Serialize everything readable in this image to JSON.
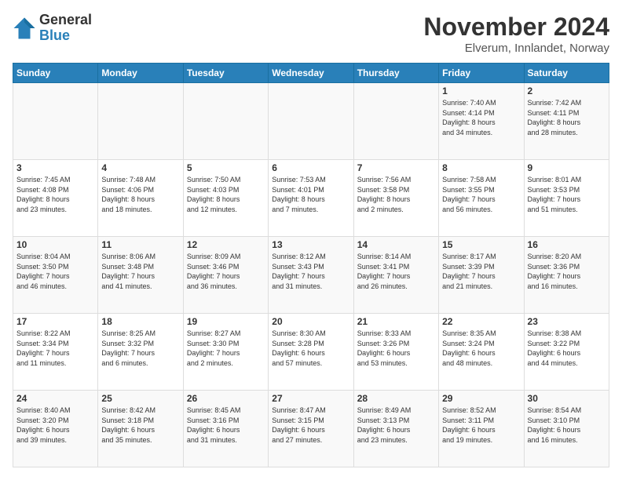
{
  "logo": {
    "general": "General",
    "blue": "Blue"
  },
  "title": "November 2024",
  "location": "Elverum, Innlandet, Norway",
  "days_of_week": [
    "Sunday",
    "Monday",
    "Tuesday",
    "Wednesday",
    "Thursday",
    "Friday",
    "Saturday"
  ],
  "weeks": [
    [
      {
        "day": "",
        "info": ""
      },
      {
        "day": "",
        "info": ""
      },
      {
        "day": "",
        "info": ""
      },
      {
        "day": "",
        "info": ""
      },
      {
        "day": "",
        "info": ""
      },
      {
        "day": "1",
        "info": "Sunrise: 7:40 AM\nSunset: 4:14 PM\nDaylight: 8 hours\nand 34 minutes."
      },
      {
        "day": "2",
        "info": "Sunrise: 7:42 AM\nSunset: 4:11 PM\nDaylight: 8 hours\nand 28 minutes."
      }
    ],
    [
      {
        "day": "3",
        "info": "Sunrise: 7:45 AM\nSunset: 4:08 PM\nDaylight: 8 hours\nand 23 minutes."
      },
      {
        "day": "4",
        "info": "Sunrise: 7:48 AM\nSunset: 4:06 PM\nDaylight: 8 hours\nand 18 minutes."
      },
      {
        "day": "5",
        "info": "Sunrise: 7:50 AM\nSunset: 4:03 PM\nDaylight: 8 hours\nand 12 minutes."
      },
      {
        "day": "6",
        "info": "Sunrise: 7:53 AM\nSunset: 4:01 PM\nDaylight: 8 hours\nand 7 minutes."
      },
      {
        "day": "7",
        "info": "Sunrise: 7:56 AM\nSunset: 3:58 PM\nDaylight: 8 hours\nand 2 minutes."
      },
      {
        "day": "8",
        "info": "Sunrise: 7:58 AM\nSunset: 3:55 PM\nDaylight: 7 hours\nand 56 minutes."
      },
      {
        "day": "9",
        "info": "Sunrise: 8:01 AM\nSunset: 3:53 PM\nDaylight: 7 hours\nand 51 minutes."
      }
    ],
    [
      {
        "day": "10",
        "info": "Sunrise: 8:04 AM\nSunset: 3:50 PM\nDaylight: 7 hours\nand 46 minutes."
      },
      {
        "day": "11",
        "info": "Sunrise: 8:06 AM\nSunset: 3:48 PM\nDaylight: 7 hours\nand 41 minutes."
      },
      {
        "day": "12",
        "info": "Sunrise: 8:09 AM\nSunset: 3:46 PM\nDaylight: 7 hours\nand 36 minutes."
      },
      {
        "day": "13",
        "info": "Sunrise: 8:12 AM\nSunset: 3:43 PM\nDaylight: 7 hours\nand 31 minutes."
      },
      {
        "day": "14",
        "info": "Sunrise: 8:14 AM\nSunset: 3:41 PM\nDaylight: 7 hours\nand 26 minutes."
      },
      {
        "day": "15",
        "info": "Sunrise: 8:17 AM\nSunset: 3:39 PM\nDaylight: 7 hours\nand 21 minutes."
      },
      {
        "day": "16",
        "info": "Sunrise: 8:20 AM\nSunset: 3:36 PM\nDaylight: 7 hours\nand 16 minutes."
      }
    ],
    [
      {
        "day": "17",
        "info": "Sunrise: 8:22 AM\nSunset: 3:34 PM\nDaylight: 7 hours\nand 11 minutes."
      },
      {
        "day": "18",
        "info": "Sunrise: 8:25 AM\nSunset: 3:32 PM\nDaylight: 7 hours\nand 6 minutes."
      },
      {
        "day": "19",
        "info": "Sunrise: 8:27 AM\nSunset: 3:30 PM\nDaylight: 7 hours\nand 2 minutes."
      },
      {
        "day": "20",
        "info": "Sunrise: 8:30 AM\nSunset: 3:28 PM\nDaylight: 6 hours\nand 57 minutes."
      },
      {
        "day": "21",
        "info": "Sunrise: 8:33 AM\nSunset: 3:26 PM\nDaylight: 6 hours\nand 53 minutes."
      },
      {
        "day": "22",
        "info": "Sunrise: 8:35 AM\nSunset: 3:24 PM\nDaylight: 6 hours\nand 48 minutes."
      },
      {
        "day": "23",
        "info": "Sunrise: 8:38 AM\nSunset: 3:22 PM\nDaylight: 6 hours\nand 44 minutes."
      }
    ],
    [
      {
        "day": "24",
        "info": "Sunrise: 8:40 AM\nSunset: 3:20 PM\nDaylight: 6 hours\nand 39 minutes."
      },
      {
        "day": "25",
        "info": "Sunrise: 8:42 AM\nSunset: 3:18 PM\nDaylight: 6 hours\nand 35 minutes."
      },
      {
        "day": "26",
        "info": "Sunrise: 8:45 AM\nSunset: 3:16 PM\nDaylight: 6 hours\nand 31 minutes."
      },
      {
        "day": "27",
        "info": "Sunrise: 8:47 AM\nSunset: 3:15 PM\nDaylight: 6 hours\nand 27 minutes."
      },
      {
        "day": "28",
        "info": "Sunrise: 8:49 AM\nSunset: 3:13 PM\nDaylight: 6 hours\nand 23 minutes."
      },
      {
        "day": "29",
        "info": "Sunrise: 8:52 AM\nSunset: 3:11 PM\nDaylight: 6 hours\nand 19 minutes."
      },
      {
        "day": "30",
        "info": "Sunrise: 8:54 AM\nSunset: 3:10 PM\nDaylight: 6 hours\nand 16 minutes."
      }
    ]
  ]
}
